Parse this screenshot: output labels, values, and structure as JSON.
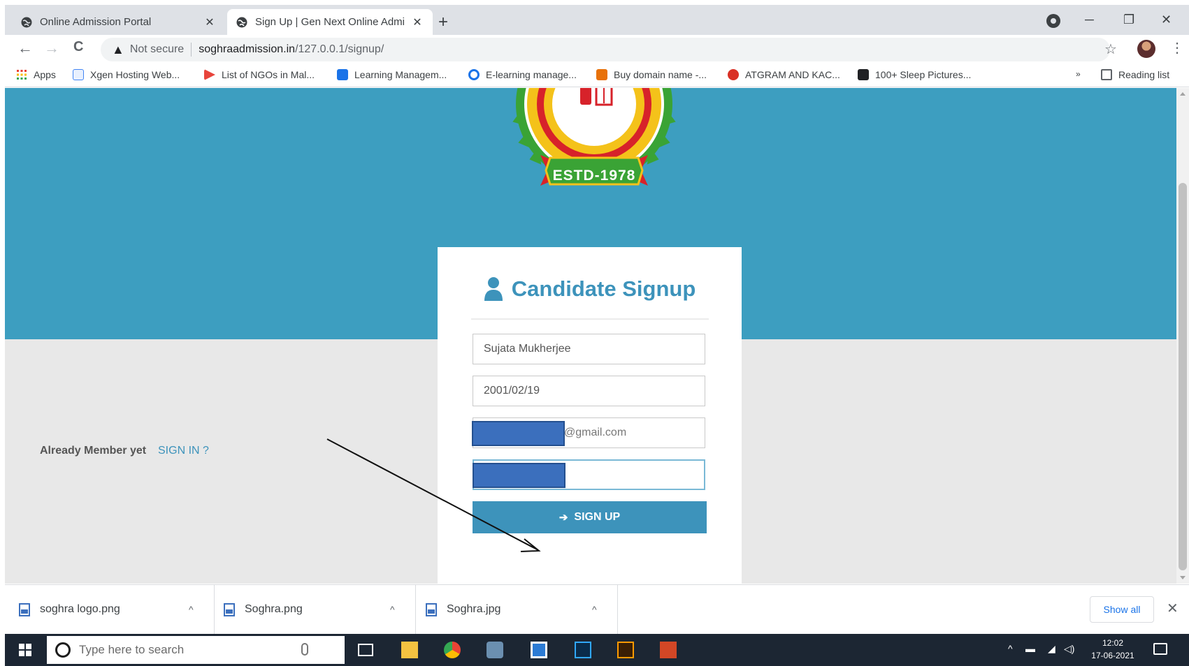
{
  "browser": {
    "tabs": [
      {
        "title": "Online Admission Portal",
        "active": false
      },
      {
        "title": "Sign Up | Gen Next Online Admi",
        "active": true
      }
    ],
    "new_tab_label": "+",
    "window_controls": {
      "minimize": "─",
      "restore": "❐",
      "close": "✕"
    },
    "nav": {
      "back": "←",
      "forward": "→",
      "reload": "C"
    },
    "omnibox": {
      "security_label": "Not secure",
      "host": "soghraadmission.in",
      "path": "/127.0.0.1/signup/"
    },
    "bookmarks": [
      {
        "label": "Apps",
        "icon": "apps-grid-icon",
        "color": "#ea4335"
      },
      {
        "label": "Xgen Hosting Web...",
        "icon": "xgen-icon",
        "color": "#4285f4"
      },
      {
        "label": "List of NGOs in Mal...",
        "icon": "ngo-icon",
        "color": "#e8453c"
      },
      {
        "label": "Learning Managem...",
        "icon": "learning-icon",
        "color": "#1a73e8"
      },
      {
        "label": "E-learning manage...",
        "icon": "elearning-icon",
        "color": "#1a73e8"
      },
      {
        "label": "Buy domain name -...",
        "icon": "domain-icon",
        "color": "#e8710a"
      },
      {
        "label": "ATGRAM AND KAC...",
        "icon": "atgram-icon",
        "color": "#d93025"
      },
      {
        "label": "100+ Sleep Pictures...",
        "icon": "sleep-icon",
        "color": "#202124"
      }
    ],
    "bookmarks_overflow": "»",
    "reading_list": "Reading list"
  },
  "page": {
    "logo_text": "ESTD-1978",
    "title": "Candidate Signup",
    "form": {
      "name_value": "Sujata Mukherjee",
      "dob_value": "2001/02/19",
      "email_suffix": "@gmail.com",
      "password_value": ""
    },
    "already_member_text": "Already Member yet",
    "signin_link": "SIGN IN ?",
    "signup_button": "SIGN UP"
  },
  "downloads": {
    "items": [
      {
        "name": "soghra logo.png"
      },
      {
        "name": "Soghra.png"
      },
      {
        "name": "Soghra.jpg"
      }
    ],
    "caret": "^",
    "show_all": "Show all",
    "close": "✕"
  },
  "taskbar": {
    "search_placeholder": "Type here to search",
    "time": "12:02",
    "date": "17-06-2021"
  },
  "colors": {
    "hero_blue": "#3d9ec0",
    "accent_blue": "#3d93bb",
    "redaction": "#3b6fbd"
  }
}
